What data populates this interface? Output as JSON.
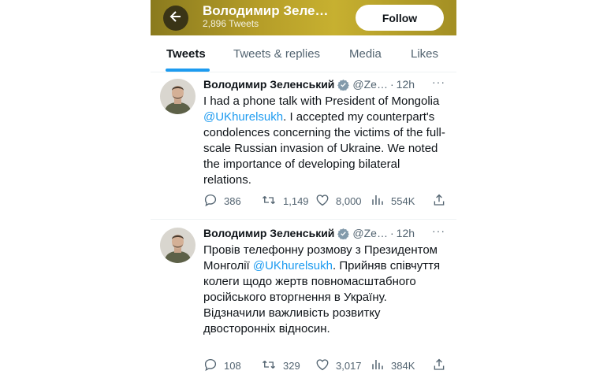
{
  "header": {
    "title": "Володимир Зеле…",
    "tweet_count": "2,896 Tweets",
    "follow_label": "Follow"
  },
  "tabs": [
    {
      "label": "Tweets",
      "active": true
    },
    {
      "label": "Tweets & replies",
      "active": false
    },
    {
      "label": "Media",
      "active": false
    },
    {
      "label": "Likes",
      "active": false
    }
  ],
  "tweets": [
    {
      "name": "Володимир Зеленський",
      "handle": "@Ze…",
      "dot": "·",
      "time": "12h",
      "text_before": "I had a phone talk with President of Mongolia ",
      "mention": "@UKhurelsukh",
      "text_after": ". I accepted my counterpart's condolences concerning the victims of the full-scale Russian invasion of Ukraine. We noted the importance of developing bilateral relations.",
      "replies": "386",
      "retweets": "1,149",
      "likes": "8,000",
      "views": "554K"
    },
    {
      "name": "Володимир Зеленський",
      "handle": "@Ze…",
      "dot": "·",
      "time": "12h",
      "text_before": "Провів телефонну розмову з Президентом Монголії ",
      "mention": "@UKhurelsukh",
      "text_after": ". Прийняв співчуття колеги щодо жертв повномасштабного російського вторгнення в Україну. Відзначили важливість розвитку двосторонніх відносин.",
      "replies": "108",
      "retweets": "329",
      "likes": "3,017",
      "views": "384K"
    }
  ],
  "more_label": "···",
  "colors": {
    "accent": "#1d9bf0",
    "header_bg": "#b59d28",
    "text_secondary": "#536471"
  },
  "icons": {
    "back": "arrow-left-icon",
    "verified": "verified-badge-icon",
    "reply": "reply-icon",
    "retweet": "retweet-icon",
    "like": "heart-icon",
    "views": "views-icon",
    "share": "share-icon"
  }
}
